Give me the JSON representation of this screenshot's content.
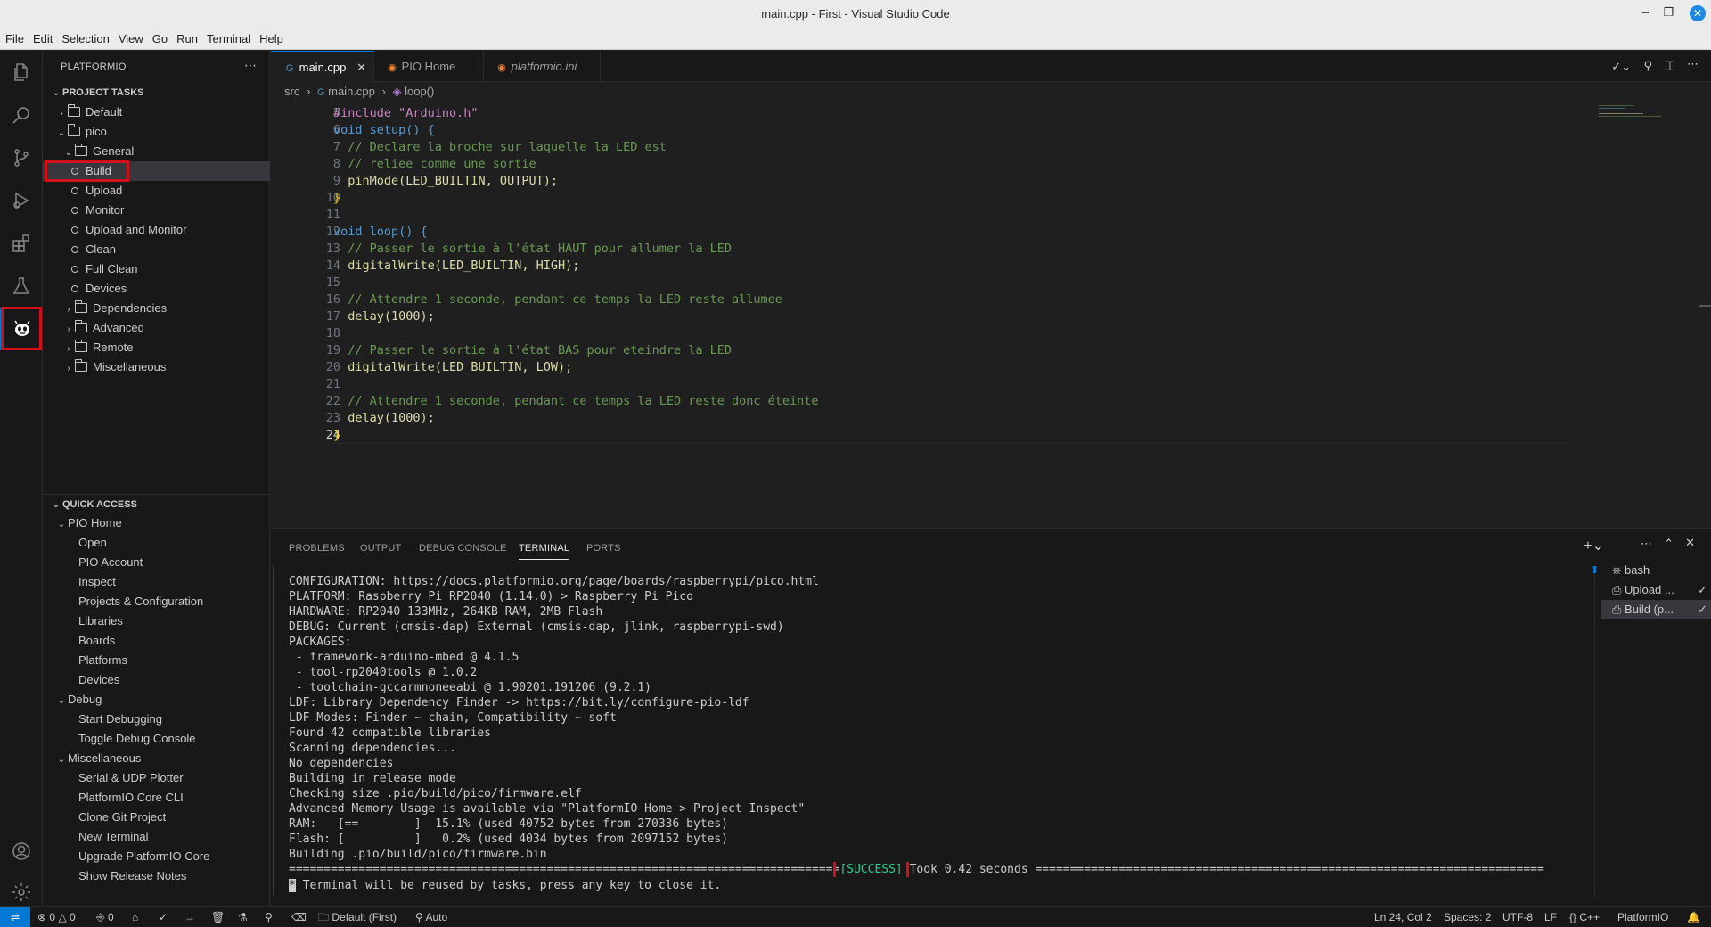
{
  "window": {
    "title": "main.cpp - First - Visual Studio Code"
  },
  "menu": [
    "File",
    "Edit",
    "Selection",
    "View",
    "Go",
    "Run",
    "Terminal",
    "Help"
  ],
  "sidebar": {
    "title": "PLATFORMIO",
    "project_tasks": {
      "header": "PROJECT TASKS",
      "items": [
        "Default",
        "pico",
        "General",
        "Build",
        "Upload",
        "Monitor",
        "Upload and Monitor",
        "Clean",
        "Full Clean",
        "Devices",
        "Dependencies",
        "Advanced",
        "Remote",
        "Miscellaneous"
      ]
    },
    "quick_access": {
      "header": "QUICK ACCESS",
      "items": [
        "PIO Home",
        "Open",
        "PIO Account",
        "Inspect",
        "Projects & Configuration",
        "Libraries",
        "Boards",
        "Platforms",
        "Devices",
        "Debug",
        "Start Debugging",
        "Toggle Debug Console",
        "Miscellaneous",
        "Serial & UDP Plotter",
        "PlatformIO Core CLI",
        "Clone Git Project",
        "New Terminal",
        "Upgrade PlatformIO Core",
        "Show Release Notes"
      ]
    }
  },
  "tabs": [
    "main.cpp",
    "PIO Home",
    "platformio.ini"
  ],
  "breadcrumb": [
    "src",
    "main.cpp",
    "loop()"
  ],
  "code": {
    "line_numbers": [
      "5",
      "6",
      "7",
      "8",
      "9",
      "10",
      "11",
      "12",
      "13",
      "14",
      "15",
      "16",
      "17",
      "18",
      "19",
      "20",
      "21",
      "22",
      "23",
      "24"
    ],
    "lines": [
      "#include \"Arduino.h\"",
      "void setup() {",
      "  // Declare la broche sur laquelle la LED est",
      "  // reliee comme une sortie",
      "  pinMode(LED_BUILTIN, OUTPUT);",
      "}",
      "",
      "void loop() {",
      "  // Passer le sortie à l'état HAUT pour allumer la LED",
      "  digitalWrite(LED_BUILTIN, HIGH);",
      "",
      "  // Attendre 1 seconde, pendant ce temps la LED reste allumee",
      "  delay(1000);",
      "",
      "  // Passer le sortie à l'état BAS pour eteindre la LED",
      "  digitalWrite(LED_BUILTIN, LOW);",
      "",
      "  // Attendre 1 seconde, pendant ce temps la LED reste donc éteinte",
      "  delay(1000);",
      "}"
    ]
  },
  "panel": {
    "tabs": [
      "PROBLEMS",
      "OUTPUT",
      "DEBUG CONSOLE",
      "TERMINAL",
      "PORTS"
    ],
    "terminal_lines": [
      "CONFIGURATION: https://docs.platformio.org/page/boards/raspberrypi/pico.html",
      "PLATFORM: Raspberry Pi RP2040 (1.14.0) > Raspberry Pi Pico",
      "HARDWARE: RP2040 133MHz, 264KB RAM, 2MB Flash",
      "DEBUG: Current (cmsis-dap) External (cmsis-dap, jlink, raspberrypi-swd)",
      "PACKAGES:",
      " - framework-arduino-mbed @ 4.1.5",
      " - tool-rp2040tools @ 1.0.2",
      " - toolchain-gccarmnoneeabi @ 1.90201.191206 (9.2.1)",
      "LDF: Library Dependency Finder -> https://bit.ly/configure-pio-ldf",
      "LDF Modes: Finder ~ chain, Compatibility ~ soft",
      "Found 42 compatible libraries",
      "Scanning dependencies...",
      "No dependencies",
      "Building in release mode",
      "Checking size .pio/build/pico/firmware.elf",
      "Advanced Memory Usage is available via \"PlatformIO Home > Project Inspect\"",
      "RAM:   [==        ]  15.1% (used 40752 bytes from 270336 bytes)",
      "Flash: [          ]   0.2% (used 4034 bytes from 2097152 bytes)",
      "Building .pio/build/pico/firmware.bin"
    ],
    "success_prefix": "===============================================================================",
    "success_label": "[SUCCESS]",
    "success_suffix": " Took 0.42 seconds =========================================================================",
    "reuse_star": "*",
    "reuse_text": " Terminal will be reused by tasks, press any key to close it.",
    "terminal_list": [
      "bash",
      "Upload ...",
      "Build (p..."
    ]
  },
  "statusbar": {
    "errors": "0",
    "warnings": "0",
    "ports": "0",
    "env": "Default (First)",
    "auto": "Auto",
    "position": "Ln 24, Col 2",
    "spaces": "Spaces: 2",
    "encoding": "UTF-8",
    "eol": "LF",
    "lang": "C++",
    "platform": "PlatformIO"
  },
  "colors": {
    "accent": "#0078d4",
    "highlight_box": "#d0101a",
    "success": "#23d18b"
  }
}
